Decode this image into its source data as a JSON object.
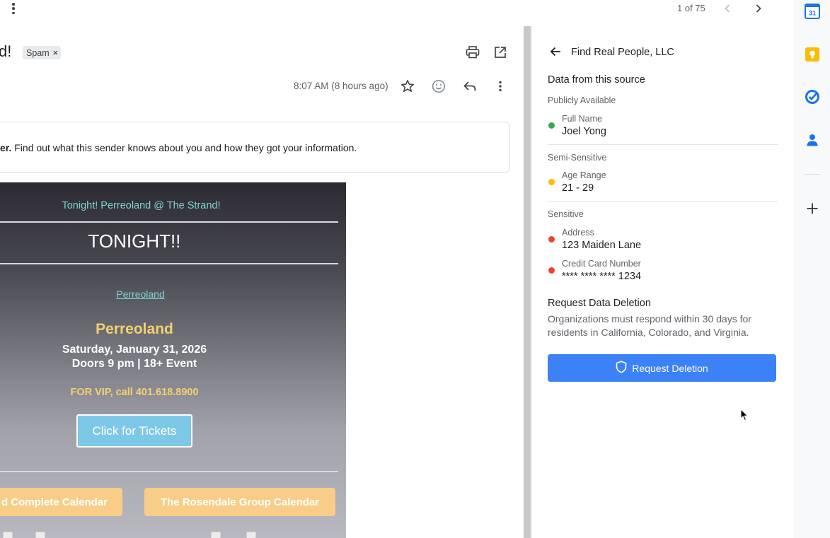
{
  "top_bar": {
    "pager_text": "1 of 75"
  },
  "email": {
    "subject_fragment": "d!",
    "label_chip": "Spam",
    "chip_close": "×",
    "timestamp": "8:07 AM (8 hours ago)",
    "info_banner": {
      "bold_fragment": "er.",
      "text": " Find out what this sender knows about you and how they got your information."
    }
  },
  "newsletter": {
    "header_line": "Tonight! Perreoland @ The Strand!",
    "headline": "TONIGHT!!",
    "link_text": "Perreoland",
    "band_name": "Perreoland",
    "date_line": "Saturday, January 31, 2026",
    "doors_line": "Doors 9 pm | 18+ Event",
    "vip_line": "FOR VIP, call 401.618.8900",
    "tickets_button": "Click for Tickets",
    "calendar_buttons": [
      "d Complete Calendar",
      "The Rosendale Group Calendar"
    ]
  },
  "side_panel": {
    "title": "Find Real People, LLC",
    "section_heading": "Data from this source",
    "categories": [
      {
        "name": "Publicly Available",
        "color": "#34a853",
        "items": [
          {
            "label": "Full Name",
            "value": "Joel Yong"
          }
        ]
      },
      {
        "name": "Semi-Sensitive",
        "color": "#fbbc04",
        "items": [
          {
            "label": "Age Range",
            "value": "21 - 29"
          }
        ]
      },
      {
        "name": "Sensitive",
        "color": "#ea4335",
        "items": [
          {
            "label": "Address",
            "value": "123 Maiden Lane"
          },
          {
            "label": "Credit Card Number",
            "value": "**** **** **** 1234"
          }
        ]
      }
    ],
    "deletion": {
      "heading": "Request Data Deletion",
      "description": "Organizations must respond within 30 days for residents in California, Colorado, and Virginia.",
      "button_label": "Request Deletion"
    }
  },
  "right_rail": {
    "calendar_badge": "31",
    "icons": [
      "calendar-icon",
      "keep-icon",
      "tasks-icon",
      "contacts-icon",
      "add-icon"
    ]
  },
  "colors": {
    "accent_blue": "#3c82f6",
    "newsletter_cyan": "#7fd3d0",
    "newsletter_gold": "#f3d16f",
    "calendar_button": "#f8cd87"
  }
}
